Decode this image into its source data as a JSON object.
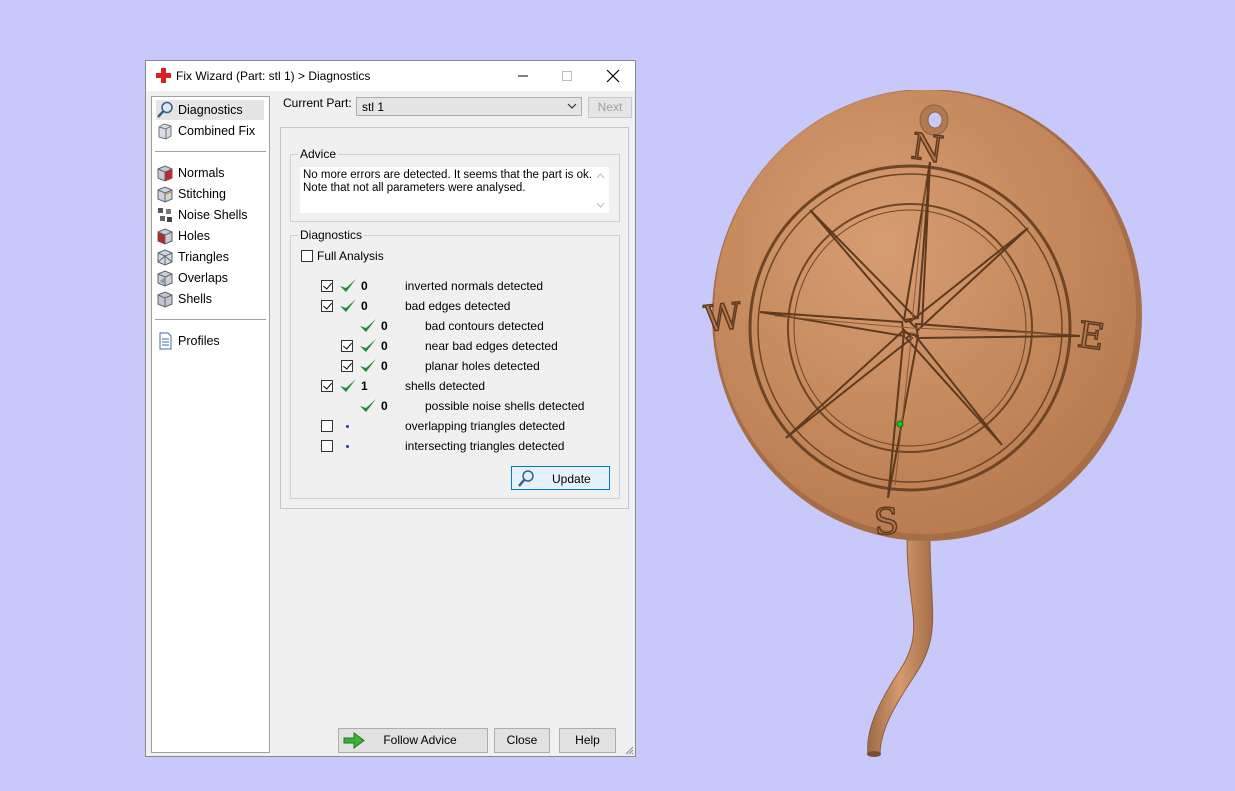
{
  "window": {
    "title": "Fix Wizard (Part: stl 1) > Diagnostics",
    "minimize_glyph": "—",
    "maximize_glyph": "□",
    "close_glyph": "✕"
  },
  "nav": {
    "items": [
      {
        "label": "Diagnostics",
        "icon": "magnifier-icon",
        "selected": true
      },
      {
        "label": "Combined Fix",
        "icon": "combined-fix-icon"
      },
      {
        "label": "Normals",
        "icon": "normals-cube-icon"
      },
      {
        "label": "Stitching",
        "icon": "stitching-cube-icon"
      },
      {
        "label": "Noise Shells",
        "icon": "noise-shells-cube-icon"
      },
      {
        "label": "Holes",
        "icon": "holes-cube-icon"
      },
      {
        "label": "Triangles",
        "icon": "triangles-cube-icon"
      },
      {
        "label": "Overlaps",
        "icon": "overlaps-cube-icon"
      },
      {
        "label": "Shells",
        "icon": "shells-cube-icon"
      },
      {
        "label": "Profiles",
        "icon": "document-icon"
      }
    ]
  },
  "current_part": {
    "label": "Current Part:",
    "value": "stl 1",
    "next_label": "Next"
  },
  "advice": {
    "group_label": "Advice",
    "line1": "No more errors are detected. It seems that the part is ok.",
    "line2": "Note that not all parameters were analysed."
  },
  "diagnostics": {
    "group_label": "Diagnostics",
    "full_analysis_label": "Full Analysis",
    "rows": [
      {
        "checked": true,
        "status": "ok",
        "count": "0",
        "label": "inverted normals detected"
      },
      {
        "checked": true,
        "status": "ok",
        "count": "0",
        "label": "bad edges detected"
      },
      {
        "checkbox": false,
        "status": "ok",
        "count": "0",
        "label": "bad contours detected"
      },
      {
        "checked": true,
        "status": "ok",
        "count": "0",
        "label": "near bad edges detected"
      },
      {
        "checked": true,
        "status": "ok",
        "count": "0",
        "label": "planar holes detected"
      },
      {
        "checked": true,
        "status": "ok",
        "count": "1",
        "label": "shells detected"
      },
      {
        "checkbox": false,
        "status": "ok",
        "count": "0",
        "label": "possible noise shells detected"
      },
      {
        "checked": false,
        "status": "not-run",
        "count": "",
        "label": "overlapping triangles detected"
      },
      {
        "checked": false,
        "status": "not-run",
        "count": "",
        "label": "intersecting triangles detected"
      }
    ],
    "update_label": "Update"
  },
  "buttons": {
    "follow_advice": "Follow Advice",
    "close": "Close",
    "help": "Help"
  },
  "model": {
    "compass_letters": {
      "n": "N",
      "s": "S",
      "e": "E",
      "w": "W"
    },
    "color": "#c98f62"
  },
  "colors": {
    "background": "#c8c8fa",
    "check_green": "#1e8c3a",
    "accent_blue": "#0078d7"
  }
}
